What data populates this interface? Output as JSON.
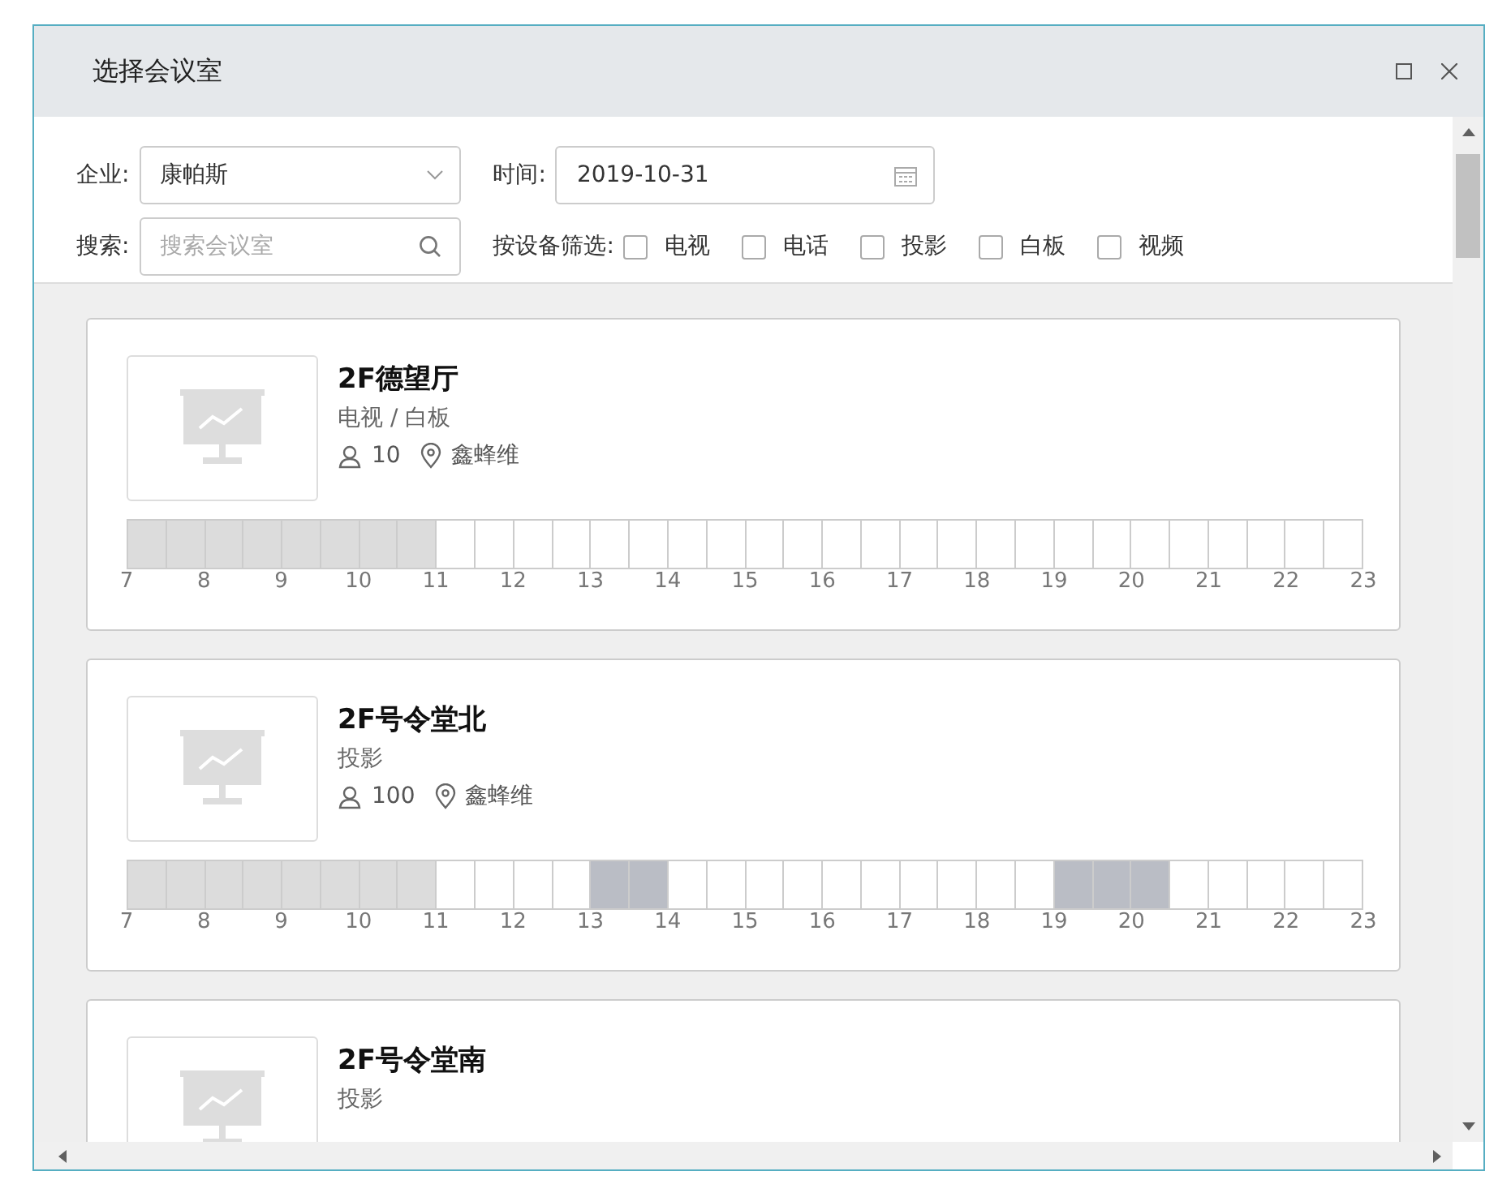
{
  "window": {
    "title": "选择会议室"
  },
  "filters": {
    "company_label": "企业:",
    "company_value": "康帕斯",
    "time_label": "时间:",
    "time_value": "2019-10-31",
    "search_label": "搜索:",
    "search_placeholder": "搜索会议室",
    "equipment_label": "按设备筛选:",
    "equipment": [
      {
        "label": "电视",
        "checked": false
      },
      {
        "label": "电话",
        "checked": false
      },
      {
        "label": "投影",
        "checked": false
      },
      {
        "label": "白板",
        "checked": false
      },
      {
        "label": "视频",
        "checked": false
      }
    ]
  },
  "rooms": [
    {
      "name": "2F德望厅",
      "facilities": "电视 / 白板",
      "capacity": "10",
      "location": "鑫蜂维",
      "slots": [
        {
          "kind": "past"
        },
        {
          "kind": "past"
        },
        {
          "kind": "past"
        },
        {
          "kind": "past"
        },
        {
          "kind": "past"
        },
        {
          "kind": "past"
        },
        {
          "kind": "past"
        },
        {
          "kind": "past"
        },
        {
          "kind": "free"
        },
        {
          "kind": "free"
        },
        {
          "kind": "free"
        },
        {
          "kind": "free"
        },
        {
          "kind": "free"
        },
        {
          "kind": "free"
        },
        {
          "kind": "free"
        },
        {
          "kind": "free"
        },
        {
          "kind": "free"
        },
        {
          "kind": "free"
        },
        {
          "kind": "free"
        },
        {
          "kind": "free"
        },
        {
          "kind": "free"
        },
        {
          "kind": "free"
        },
        {
          "kind": "free"
        },
        {
          "kind": "free"
        },
        {
          "kind": "free"
        },
        {
          "kind": "free"
        },
        {
          "kind": "free"
        },
        {
          "kind": "free"
        },
        {
          "kind": "free"
        },
        {
          "kind": "free"
        },
        {
          "kind": "free"
        },
        {
          "kind": "free"
        }
      ],
      "hours": [
        "7",
        "8",
        "9",
        "10",
        "11",
        "12",
        "13",
        "14",
        "15",
        "16",
        "17",
        "18",
        "19",
        "20",
        "21",
        "22",
        "23"
      ]
    },
    {
      "name": "2F号令堂北",
      "facilities": "投影",
      "capacity": "100",
      "location": "鑫蜂维",
      "slots": [
        {
          "kind": "past"
        },
        {
          "kind": "past"
        },
        {
          "kind": "past"
        },
        {
          "kind": "past"
        },
        {
          "kind": "past"
        },
        {
          "kind": "past"
        },
        {
          "kind": "past"
        },
        {
          "kind": "past"
        },
        {
          "kind": "free"
        },
        {
          "kind": "free"
        },
        {
          "kind": "free"
        },
        {
          "kind": "free"
        },
        {
          "kind": "booked"
        },
        {
          "kind": "booked"
        },
        {
          "kind": "free"
        },
        {
          "kind": "free"
        },
        {
          "kind": "free"
        },
        {
          "kind": "free"
        },
        {
          "kind": "free"
        },
        {
          "kind": "free"
        },
        {
          "kind": "free"
        },
        {
          "kind": "free"
        },
        {
          "kind": "free"
        },
        {
          "kind": "free"
        },
        {
          "kind": "booked"
        },
        {
          "kind": "booked"
        },
        {
          "kind": "booked"
        },
        {
          "kind": "free"
        },
        {
          "kind": "free"
        },
        {
          "kind": "free"
        },
        {
          "kind": "free"
        },
        {
          "kind": "free"
        }
      ],
      "hours": [
        "7",
        "8",
        "9",
        "10",
        "11",
        "12",
        "13",
        "14",
        "15",
        "16",
        "17",
        "18",
        "19",
        "20",
        "21",
        "22",
        "23"
      ]
    },
    {
      "name": "2F号令堂南",
      "facilities": "投影"
    }
  ]
}
